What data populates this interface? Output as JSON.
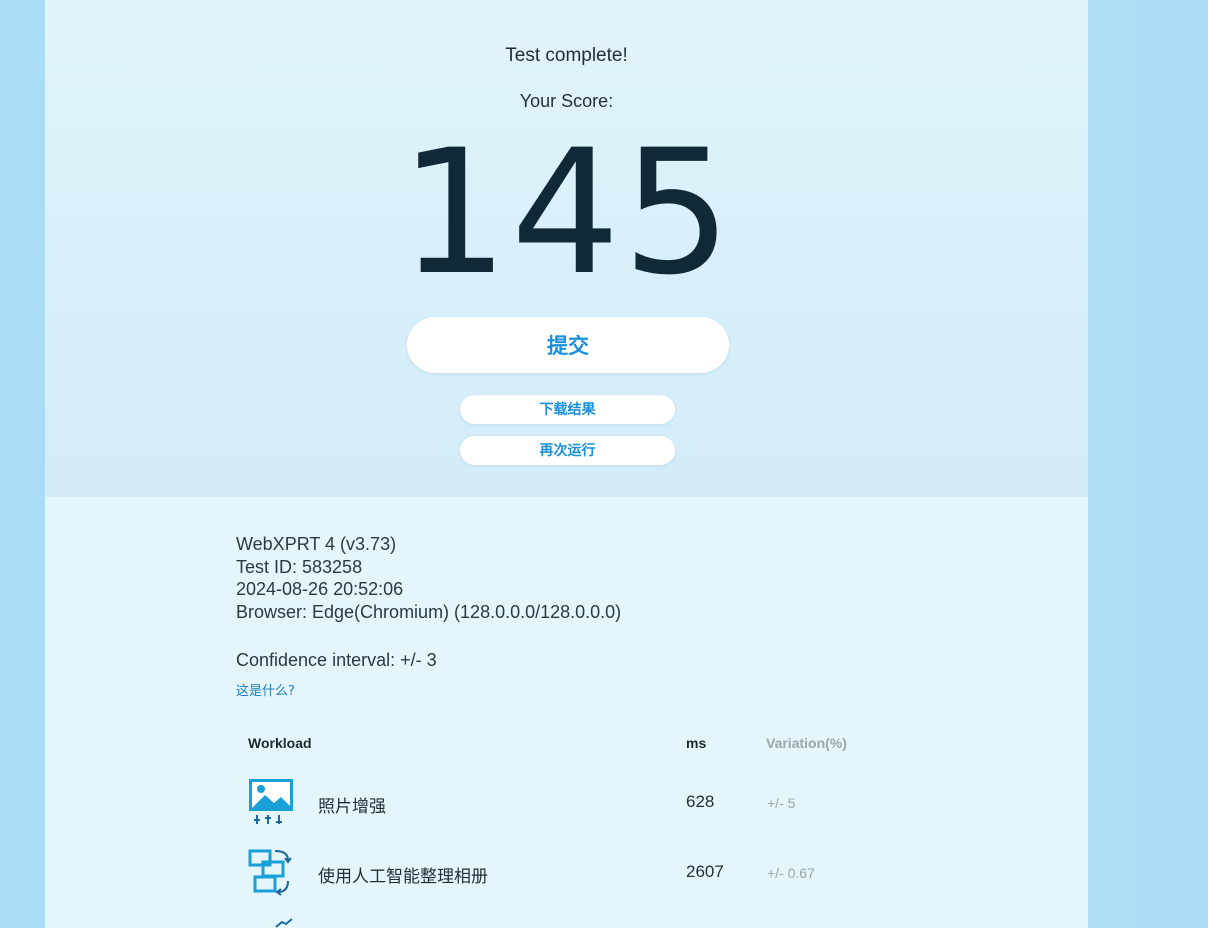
{
  "hero": {
    "status": "Test complete!",
    "score_label": "Your Score:",
    "score": "145",
    "submit_label": "提交",
    "download_label": "下载结果",
    "rerun_label": "再次运行"
  },
  "details": {
    "version": "WebXPRT 4 (v3.73)",
    "test_id": "Test ID: 583258",
    "datetime": "2024-08-26 20:52:06",
    "browser": "Browser: Edge(Chromium) (128.0.0.0/128.0.0.0)",
    "confidence": "Confidence interval: +/- 3",
    "what_link": "这是什么?"
  },
  "table": {
    "headers": {
      "workload": "Workload",
      "ms": "ms",
      "variation": "Variation(%)"
    },
    "rows": [
      {
        "icon": "photo-enhance-icon",
        "name": "照片增强",
        "ms": "628",
        "variation": "+/- 5"
      },
      {
        "icon": "album-organize-icon",
        "name": "使用人工智能整理相册",
        "ms": "2607",
        "variation": "+/- 0.67"
      },
      {
        "icon": "trend-chart-icon",
        "name": "",
        "ms": "",
        "variation": ""
      }
    ]
  },
  "colors": {
    "accent": "#1a8fdc",
    "icon": "#1aa0d8",
    "score_text": "#0f2a36",
    "muted": "#9aa6ad"
  }
}
